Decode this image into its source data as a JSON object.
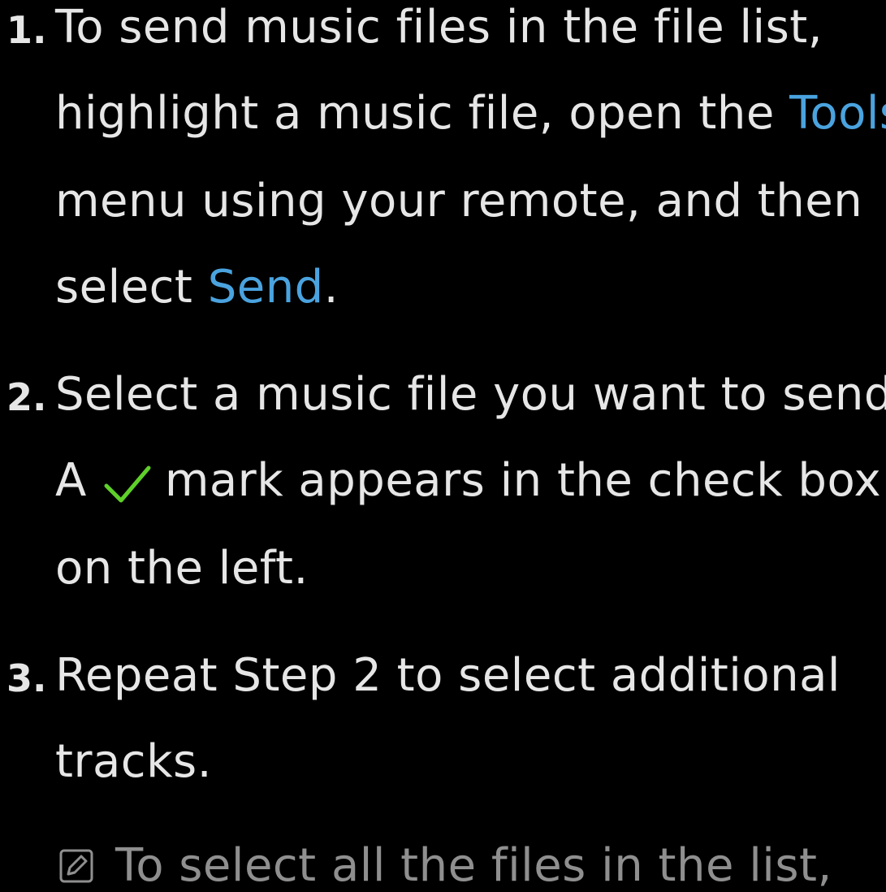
{
  "steps": [
    {
      "number": "1.",
      "line1": "To send music files in the file list,",
      "line2_a": "highlight a music file, open the ",
      "line2_hl": "Tools",
      "line3": "menu using your remote, and then",
      "line4_a": "select ",
      "line4_hl": "Send",
      "line4_b": "."
    },
    {
      "number": "2.",
      "line1": "Select a music file you want to send.",
      "line2_a": "A",
      "line2_b": "mark appears in the check box",
      "line3": "on the left."
    },
    {
      "number": "3.",
      "line1": "Repeat Step 2 to select additional",
      "line2": "tracks."
    }
  ],
  "note": {
    "icon": "note-icon",
    "text": "To select all the files in the list,"
  },
  "colors": {
    "background": "#000000",
    "text": "#e6e6e6",
    "highlight": "#4aa3df",
    "check": "#5fd02a",
    "note": "#8f8f8f"
  }
}
